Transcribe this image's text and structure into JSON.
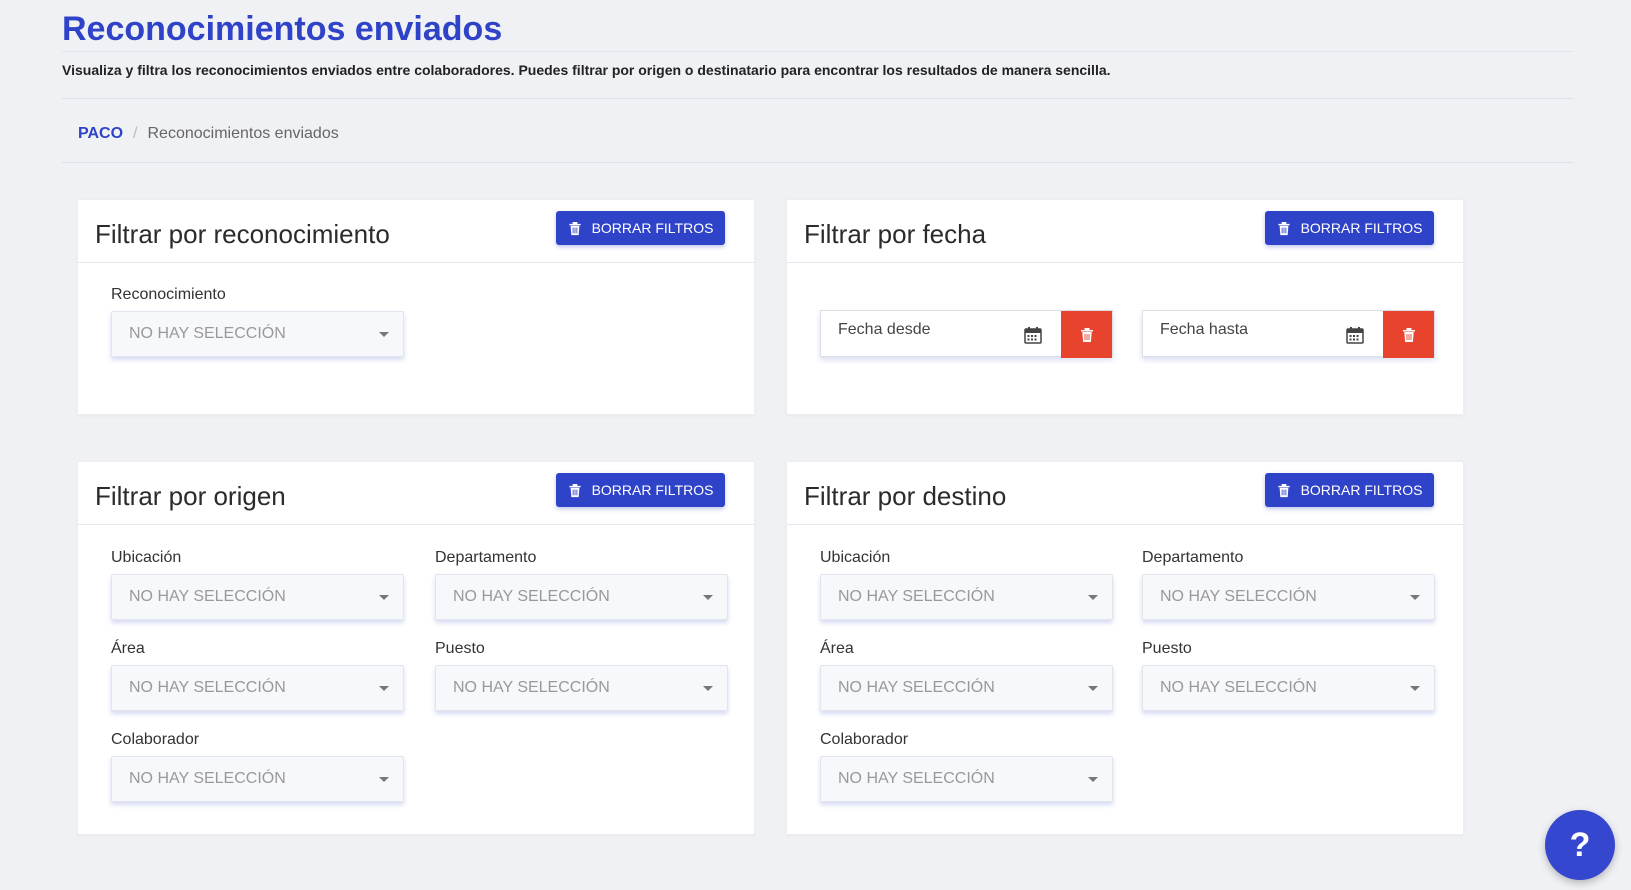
{
  "header": {
    "title": "Reconocimientos enviados",
    "description": "Visualiza y filtra los reconocimientos enviados entre colaboradores. Puedes filtrar por origen o destinatario para encontrar los resultados de manera sencilla."
  },
  "breadcrumb": {
    "root": "PACO",
    "separator": "/",
    "current": "Reconocimientos enviados"
  },
  "common": {
    "clear_label": "BORRAR FILTROS",
    "no_selection": "NO HAY SELECCIÓN"
  },
  "recognition_card": {
    "title": "Filtrar por reconocimiento",
    "field_label": "Reconocimiento",
    "field_value": "NO HAY SELECCIÓN"
  },
  "date_card": {
    "title": "Filtrar por fecha",
    "from_placeholder": "Fecha desde",
    "to_placeholder": "Fecha hasta"
  },
  "origin_card": {
    "title": "Filtrar por origen",
    "location_label": "Ubicación",
    "department_label": "Departamento",
    "area_label": "Área",
    "position_label": "Puesto",
    "collaborator_label": "Colaborador"
  },
  "destination_card": {
    "title": "Filtrar por destino",
    "location_label": "Ubicación",
    "department_label": "Departamento",
    "area_label": "Área",
    "position_label": "Puesto",
    "collaborator_label": "Colaborador"
  },
  "help": {
    "label": "?"
  },
  "colors": {
    "primary": "#2f43c8",
    "danger": "#e8432c",
    "background": "#f0f1f4"
  },
  "icons": {
    "clear": "trash-icon",
    "calendar": "calendar-icon",
    "help": "help-icon"
  }
}
